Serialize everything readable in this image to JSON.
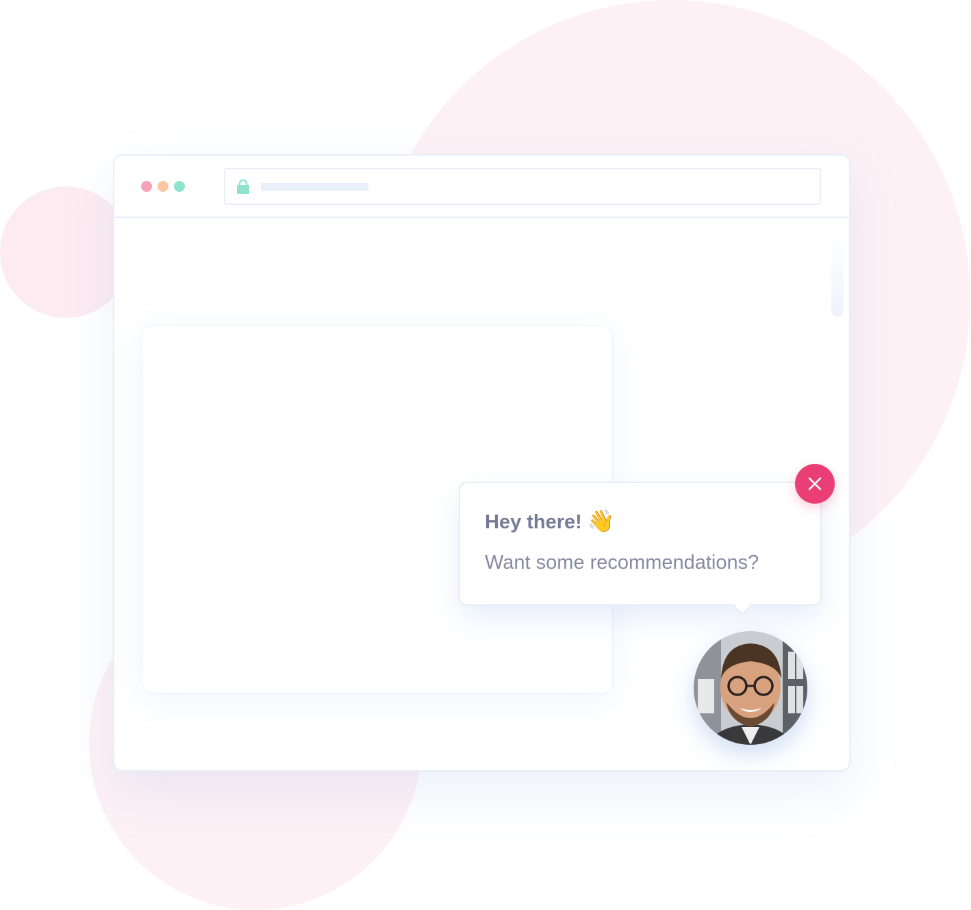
{
  "browser": {
    "window_controls": [
      "close",
      "minimize",
      "maximize"
    ],
    "address_bar": {
      "icon": "lock-icon",
      "url": ""
    }
  },
  "chat_popup": {
    "greeting": "Hey there!",
    "greeting_emoji": "👋",
    "message": "Want some recommendations?",
    "close_icon": "close-icon",
    "avatar_icon": "agent-avatar"
  },
  "colors": {
    "accent": "#ea3f76",
    "background_blob": "#fdf1f5",
    "text_title": "#757b96",
    "text_body": "#868ba2"
  }
}
